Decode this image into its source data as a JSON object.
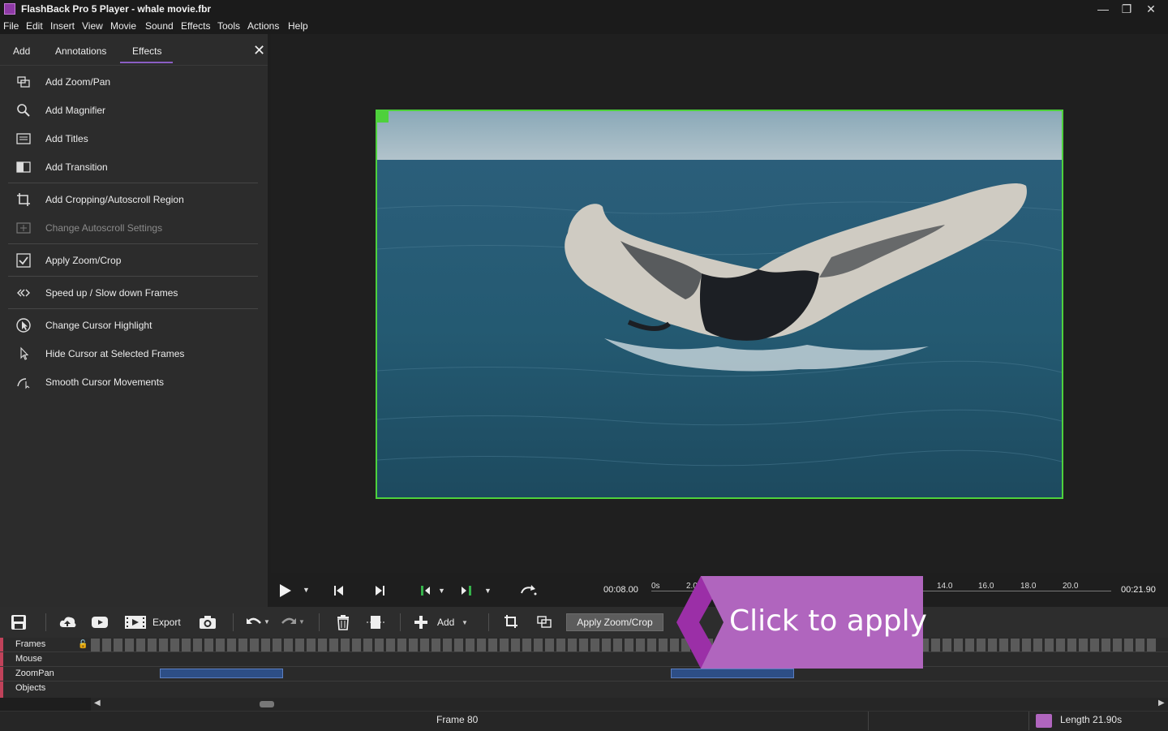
{
  "window": {
    "title": "FlashBack Pro 5 Player - whale movie.fbr"
  },
  "menu": [
    "File",
    "Edit",
    "Insert",
    "View",
    "Movie",
    "Sound",
    "Effects",
    "Tools",
    "Actions",
    "Help"
  ],
  "panel": {
    "tabs": [
      "Add",
      "Annotations",
      "Effects"
    ],
    "active_tab": "Effects",
    "items": [
      {
        "label": "Add Zoom/Pan",
        "icon": "zoom-pan-icon",
        "enabled": true
      },
      {
        "label": "Add Magnifier",
        "icon": "magnifier-icon",
        "enabled": true
      },
      {
        "label": "Add Titles",
        "icon": "titles-icon",
        "enabled": true
      },
      {
        "label": "Add Transition",
        "icon": "transition-icon",
        "enabled": true
      },
      {
        "label": "Add Cropping/Autoscroll Region",
        "icon": "crop-icon",
        "enabled": true
      },
      {
        "label": "Change Autoscroll Settings",
        "icon": "autoscroll-icon",
        "enabled": false
      },
      {
        "label": "Apply Zoom/Crop",
        "icon": "apply-check-icon",
        "enabled": true
      },
      {
        "label": "Speed up / Slow down Frames",
        "icon": "speed-icon",
        "enabled": true
      },
      {
        "label": "Change Cursor Highlight",
        "icon": "cursor-highlight-icon",
        "enabled": true
      },
      {
        "label": "Hide Cursor at Selected Frames",
        "icon": "cursor-icon",
        "enabled": true
      },
      {
        "label": "Smooth Cursor Movements",
        "icon": "smooth-cursor-icon",
        "enabled": true
      }
    ]
  },
  "transport": {
    "current_time": "00:08.00",
    "total_time": "00:21.90",
    "ruler": [
      "0s",
      "2.0",
      "14.0",
      "16.0",
      "18.0",
      "20.0"
    ]
  },
  "toolbar": {
    "export_label": "Export",
    "add_label": "Add",
    "apply_label": "Apply Zoom/Crop"
  },
  "tracks": [
    "Frames",
    "Mouse",
    "ZoomPan",
    "Objects"
  ],
  "status": {
    "frame": "Frame 80",
    "length": "Length 21.90s"
  },
  "callout": {
    "text": "Click to apply"
  },
  "colors": {
    "accent": "#8a5ec4",
    "selection_border": "#4ed13c",
    "callout": "#b065be",
    "track_marker": "#c0425a"
  }
}
